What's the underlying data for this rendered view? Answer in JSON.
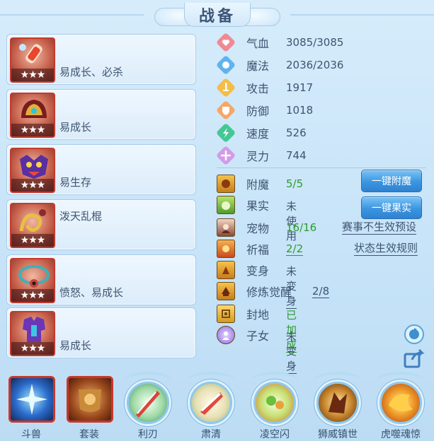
{
  "title": "战备",
  "equipment": [
    {
      "desc": "易成长、必杀",
      "stars": "★★★",
      "icon": "popsicle-icon"
    },
    {
      "desc": "易成长",
      "stars": "★★★",
      "icon": "helmet-icon"
    },
    {
      "desc": "易生存",
      "stars": "★★★",
      "icon": "demon-mask-icon"
    },
    {
      "desc": "泼天乱棍",
      "stars": "★★★",
      "icon": "serpent-chain-icon"
    },
    {
      "desc": "愤怒、易成长",
      "stars": "★★★",
      "icon": "eye-necklace-icon"
    },
    {
      "desc": "易成长",
      "stars": "★★★",
      "icon": "armor-icon"
    }
  ],
  "stats": [
    {
      "label": "气血",
      "value": "3085/3085",
      "icon": "heart-icon",
      "color": "#e96a7a"
    },
    {
      "label": "魔法",
      "value": "2036/2036",
      "icon": "mana-orb-icon",
      "color": "#4ea8ea"
    },
    {
      "label": "攻击",
      "value": "1917",
      "icon": "sword-icon",
      "color": "#f2b43c"
    },
    {
      "label": "防御",
      "value": "1018",
      "icon": "shield-icon",
      "color": "#f39a56"
    },
    {
      "label": "速度",
      "value": "526",
      "icon": "lightning-icon",
      "color": "#3fc58e"
    },
    {
      "label": "灵力",
      "value": "744",
      "icon": "spirit-icon",
      "color": "#c98ee0"
    }
  ],
  "attrs": [
    {
      "label": "附魔",
      "value": "5/5",
      "icon": "enchant-icon"
    },
    {
      "label": "果实",
      "value": "未使用",
      "icon": "fruit-icon"
    },
    {
      "label": "宠物",
      "value": "16/16",
      "icon": "pet-portrait-icon"
    },
    {
      "label": "祈福",
      "value": "2/2",
      "icon": "blessing-icon"
    },
    {
      "label": "变身",
      "value": "未变身",
      "icon": "transform-icon"
    },
    {
      "label": "修炼觉醒",
      "value": "2/8",
      "icon": "cultivation-icon"
    },
    {
      "label": "封地",
      "value": "已加成",
      "icon": "fief-icon"
    },
    {
      "label": "子女",
      "value": "未变身",
      "icon": "child-icon"
    }
  ],
  "buttons": {
    "enchant": "一键附魔",
    "fruit": "一键果实"
  },
  "links": {
    "event_preset": "赛事不生效预设",
    "status_rules": "状态生效规则"
  },
  "skills": [
    {
      "label": "斗兽",
      "icon": "beast-fight-icon",
      "style": "square"
    },
    {
      "label": "套装",
      "icon": "suit-icon",
      "style": "square"
    },
    {
      "label": "利刃",
      "icon": "blade-icon",
      "style": "round"
    },
    {
      "label": "肃清",
      "icon": "purge-icon",
      "style": "round"
    },
    {
      "label": "凌空闪",
      "icon": "sky-flash-icon",
      "style": "round"
    },
    {
      "label": "狮威镇世",
      "icon": "lion-might-icon",
      "style": "round"
    },
    {
      "label": "虎噬魂惊",
      "icon": "tiger-soul-icon",
      "style": "round"
    }
  ]
}
